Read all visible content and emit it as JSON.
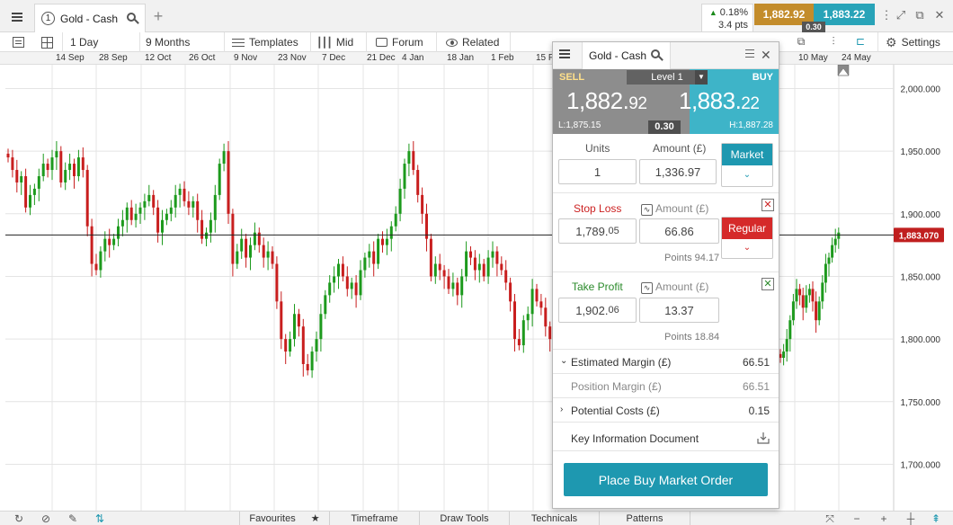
{
  "tabbar": {
    "tab_number": "1",
    "tab_title": "Gold - Cash",
    "add_tab": "+",
    "change_pct": "0.18%",
    "change_pts": "3.4 pts",
    "sell_price": "1,882.92",
    "buy_price": "1,883.22",
    "spread": "0.30"
  },
  "toolbar": {
    "timeframe": "1 Day",
    "range": "9 Months",
    "templates": "Templates",
    "price_type": "Mid",
    "forum": "Forum",
    "related": "Related",
    "settings": "Settings"
  },
  "date_axis": [
    "14 Sep",
    "28 Sep",
    "12 Oct",
    "26 Oct",
    "9 Nov",
    "23 Nov",
    "7 Dec",
    "21 Dec",
    "4 Jan",
    "18 Jan",
    "1 Feb",
    "15 F",
    "10 May",
    "24 May"
  ],
  "chart_data": {
    "type": "candlestick",
    "y_ticks": [
      2000000,
      1950000,
      1900000,
      1850000,
      1800000,
      1750000,
      1700000
    ],
    "y_tick_labels": [
      "2,000.000",
      "1,950.000",
      "1,900.000",
      "1,850.000",
      "1,800.000",
      "1,750.000",
      "1,700.000"
    ],
    "ylim": [
      1663,
      2019
    ],
    "current_price_label": "1,883.070",
    "current_price": 1883.07,
    "colors": {
      "up": "#1d9a1d",
      "down": "#c81e1e",
      "line": "#222222",
      "grid": "#e4e4e4"
    },
    "close_series": [
      1945,
      1935,
      1925,
      1930,
      1905,
      1915,
      1920,
      1930,
      1940,
      1935,
      1945,
      1950,
      1925,
      1935,
      1940,
      1930,
      1945,
      1935,
      1890,
      1860,
      1855,
      1870,
      1880,
      1875,
      1880,
      1890,
      1895,
      1905,
      1895,
      1900,
      1905,
      1910,
      1915,
      1905,
      1885,
      1895,
      1900,
      1905,
      1915,
      1920,
      1910,
      1905,
      1910,
      1895,
      1880,
      1885,
      1895,
      1915,
      1940,
      1950,
      1900,
      1860,
      1870,
      1880,
      1865,
      1875,
      1885,
      1875,
      1865,
      1870,
      1860,
      1830,
      1800,
      1790,
      1800,
      1820,
      1810,
      1780,
      1775,
      1790,
      1800,
      1820,
      1835,
      1845,
      1850,
      1860,
      1850,
      1840,
      1845,
      1835,
      1855,
      1865,
      1870,
      1860,
      1880,
      1875,
      1880,
      1890,
      1900,
      1920,
      1940,
      1950,
      1935,
      1915,
      1900,
      1880,
      1850,
      1860,
      1855,
      1850,
      1840,
      1845,
      1835,
      1850,
      1870,
      1865,
      1855,
      1860,
      1850,
      1865,
      1870,
      1860,
      1855,
      1845,
      1830,
      1800,
      1795,
      1815,
      1820,
      1840,
      1830,
      1825,
      1810,
      1800,
      1795,
      1780
    ],
    "close_series_right": [
      1785,
      1790,
      1800,
      1815,
      1830,
      1840,
      1835,
      1825,
      1835,
      1840,
      1830,
      1815,
      1830,
      1845,
      1860,
      1865,
      1875,
      1880,
      1885
    ]
  },
  "ticket": {
    "title": "Gold - Cash",
    "level": "Level 1",
    "sell_label": "SELL",
    "buy_label": "BUY",
    "sell_main": "1,882.",
    "sell_small": "92",
    "buy_main": "1,883.",
    "buy_small": "22",
    "low": "L:1,875.15",
    "high": "H:1,887.28",
    "spread": "0.30",
    "units_label": "Units",
    "amount_label": "Amount (£)",
    "units_value": "1",
    "amount_value": "1,336.97",
    "market_btn": "Market",
    "stop_loss_label": "Stop Loss",
    "stop_amount_label": "Amount (£)",
    "stop_main": "1,789.",
    "stop_small": "05",
    "stop_amount": "66.86",
    "stop_points": "Points 94.17",
    "regular_btn": "Regular",
    "take_profit_label": "Take Profit",
    "tp_amount_label": "Amount (£)",
    "tp_main": "1,902.",
    "tp_small": "06",
    "tp_amount": "13.37",
    "tp_points": "Points 18.84",
    "est_margin_label": "Estimated Margin (£)",
    "est_margin_value": "66.51",
    "pos_margin_label": "Position Margin (£)",
    "pos_margin_value": "66.51",
    "costs_label": "Potential Costs (£)",
    "costs_value": "0.15",
    "kid_label": "Key Information Document",
    "buy_order_btn": "Place Buy Market Order"
  },
  "bottombar": {
    "favourites": "Favourites",
    "timeframe": "Timeframe",
    "draw_tools": "Draw Tools",
    "technicals": "Technicals",
    "patterns": "Patterns"
  }
}
